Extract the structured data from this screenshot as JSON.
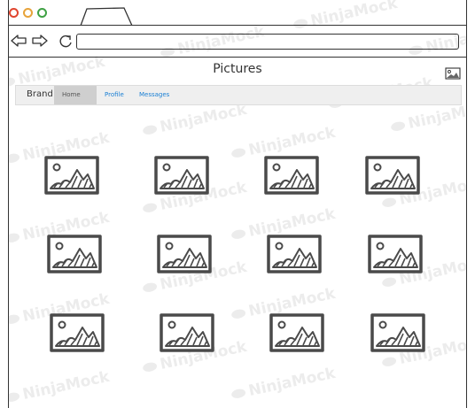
{
  "window": {
    "tab_label": "",
    "url_value": ""
  },
  "page": {
    "title": "Pictures"
  },
  "menu": {
    "brand": "Brand",
    "items": [
      {
        "label": "Home",
        "active": true
      },
      {
        "label": "Profile",
        "active": false
      },
      {
        "label": "Messages",
        "active": false
      }
    ]
  },
  "watermark_text": "NinjaMock",
  "icons": {
    "header": "image-icon",
    "grid": "image-placeholder-icon"
  },
  "grid": {
    "rows": 3,
    "cols": 4,
    "items": [
      {
        "alt": ""
      },
      {
        "alt": ""
      },
      {
        "alt": ""
      },
      {
        "alt": ""
      },
      {
        "alt": ""
      },
      {
        "alt": ""
      },
      {
        "alt": ""
      },
      {
        "alt": ""
      },
      {
        "alt": ""
      },
      {
        "alt": ""
      },
      {
        "alt": ""
      },
      {
        "alt": ""
      }
    ]
  },
  "colors": {
    "link": "#1a7fd4",
    "active_tab_bg": "#cfcfcf",
    "menu_bg": "#efefef"
  }
}
